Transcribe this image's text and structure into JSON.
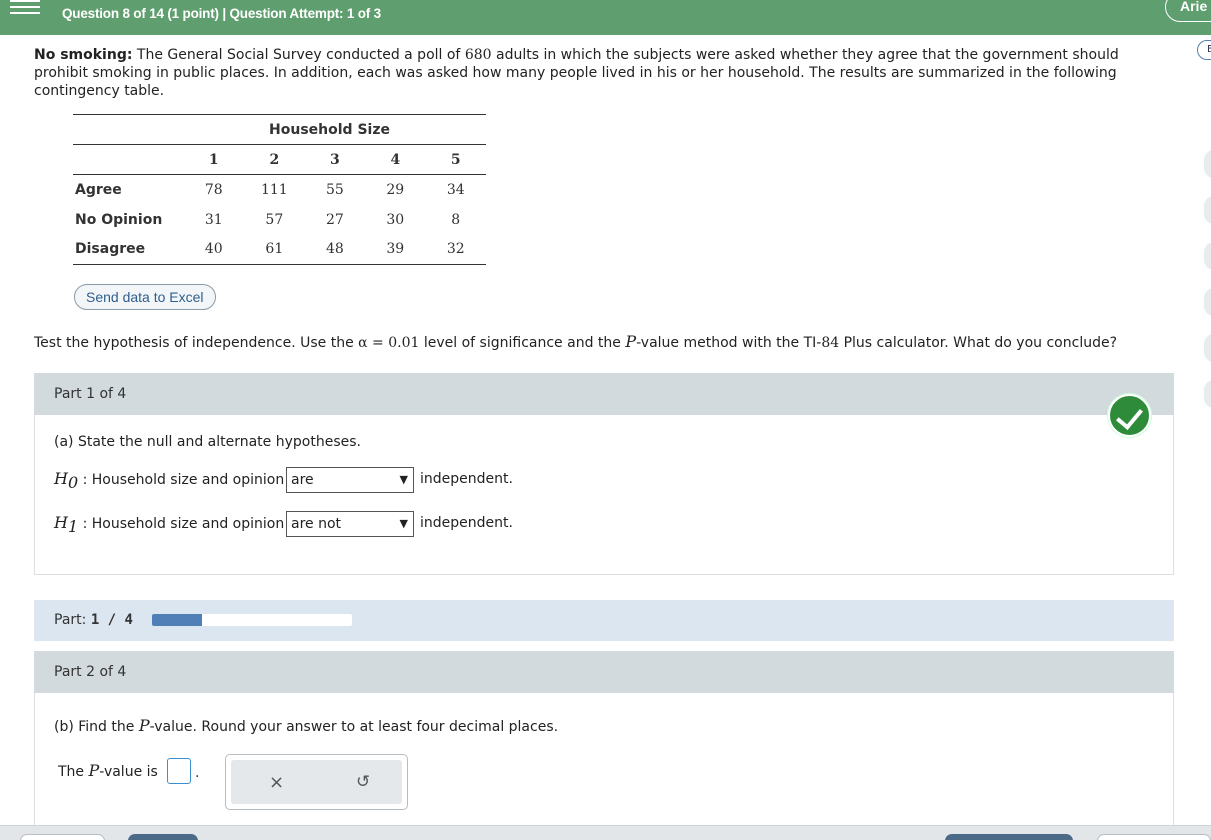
{
  "header": {
    "question_info": "Question 8 of 14 (1 point)  |  Question Attempt: 1 of 3",
    "user_label": "Arie",
    "edge_badge": "E"
  },
  "intro": {
    "lead": "No smoking:",
    "text_1": " The General Social Survey conducted a poll of ",
    "n": "680",
    "text_2": " adults in which the subjects were asked whether they agree that the government should prohibit smoking in public places. In addition, each was asked how many people lived in his or her household. The results are summarized in the following contingency table."
  },
  "table": {
    "title": "Household Size",
    "columns": [
      "1",
      "2",
      "3",
      "4",
      "5"
    ],
    "rows": [
      {
        "label": "Agree",
        "values": [
          "78",
          "111",
          "55",
          "29",
          "34"
        ]
      },
      {
        "label": "No Opinion",
        "values": [
          "31",
          "57",
          "27",
          "30",
          "8"
        ]
      },
      {
        "label": "Disagree",
        "values": [
          "40",
          "61",
          "48",
          "39",
          "32"
        ]
      }
    ]
  },
  "excel_button": "Send data to Excel",
  "instruction": {
    "t1": "Test the hypothesis of independence. Use the ",
    "alpha": "α = 0.01",
    "t2": " level of significance and the ",
    "p": "P",
    "t3": "-value method with the TI-",
    "model": "84",
    "t4": " Plus calculator. What do you conclude?"
  },
  "part1": {
    "heading": "Part 1 of 4",
    "question": "(a) State the null and alternate hypotheses.",
    "h0_var": "H",
    "h0_sub": "0",
    "h0_text": ": Household size and opinion",
    "h0_select": "are",
    "h1_var": "H",
    "h1_sub": "1",
    "h1_text": ": Household size and opinion",
    "h1_select": "are not",
    "suffix": "independent.",
    "status_icon": "check-icon"
  },
  "progress": {
    "label": "Part:",
    "value_text": "1 / 4",
    "fraction": 0.25,
    "color": "#4f7fb6"
  },
  "part2": {
    "heading": "Part 2 of 4",
    "q1": "(b) Find the ",
    "p": "P",
    "q2": "-value. Round your answer to at least four decimal places.",
    "answer_prefix": "The ",
    "answer_suffix": "-value is",
    "period": ".",
    "clear_icon": "×",
    "undo_icon": "↺"
  }
}
